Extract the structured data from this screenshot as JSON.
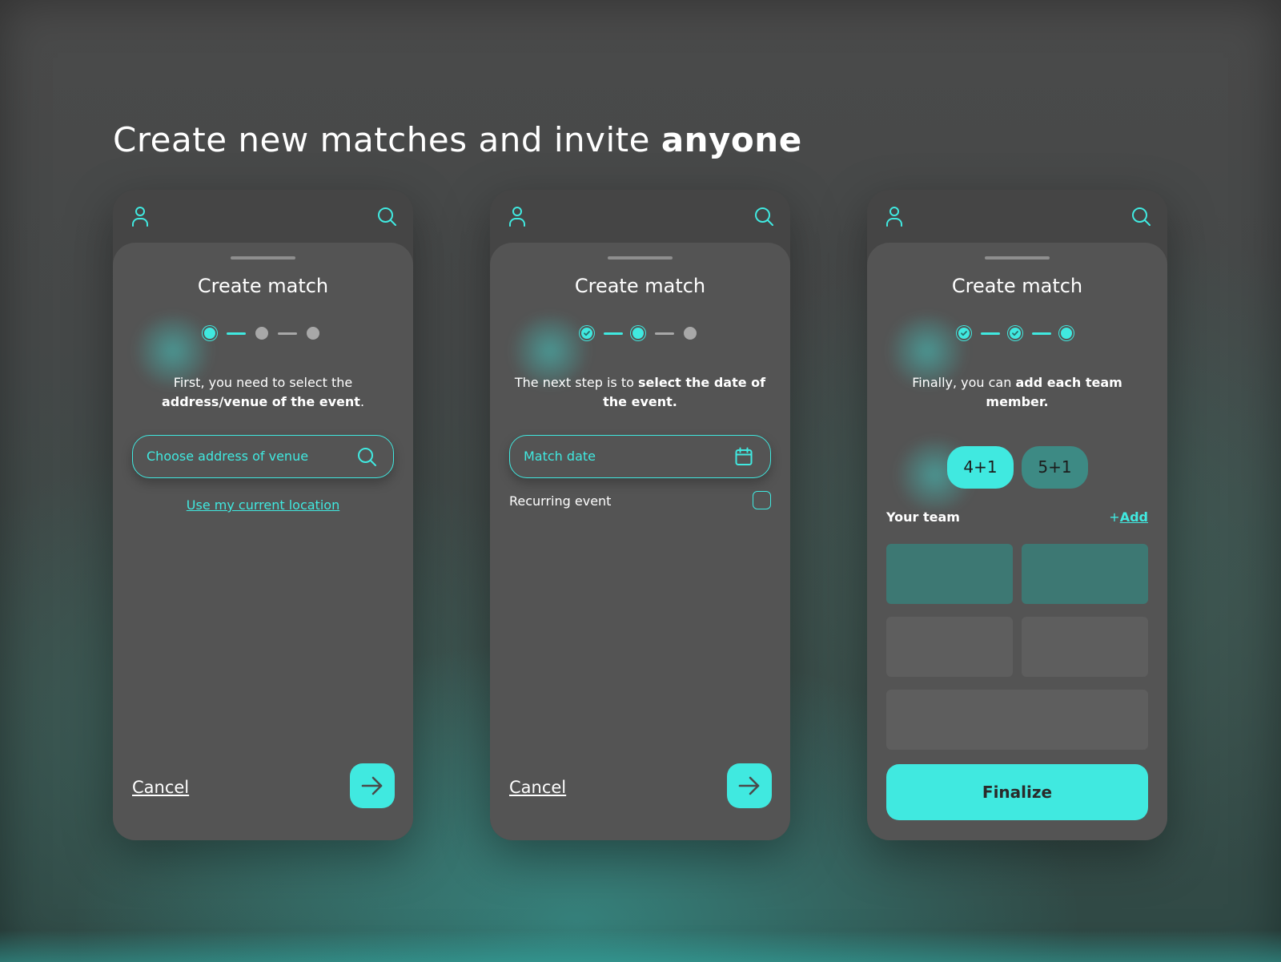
{
  "headline": {
    "regular": "Create new matches and invite ",
    "bold": "anyone"
  },
  "colors": {
    "accent": "#40e9e0",
    "card": "#545454",
    "topbar": "#454545",
    "slot_filled": "#3d7873",
    "slot_empty": "#5e5e5e"
  },
  "icons": {
    "profile": "user-icon",
    "search": "search-icon",
    "calendar": "calendar-icon",
    "next": "arrow-right-icon",
    "check": "check-icon",
    "add": "plus-icon"
  },
  "screens": [
    {
      "title": "Create match",
      "steps": [
        "current",
        "pending",
        "pending"
      ],
      "desc_regular": "First, you need to select the ",
      "desc_bold": "address/venue of the event",
      "desc_end": ".",
      "field_placeholder": "Choose address of venue",
      "location_link": "Use my current location",
      "cancel": "Cancel"
    },
    {
      "title": "Create match",
      "steps": [
        "done",
        "current",
        "pending"
      ],
      "desc_regular": "The next step is to ",
      "desc_bold": "select the date of the event.",
      "field_placeholder": "Match date",
      "recurring_label": "Recurring event",
      "recurring_checked": false,
      "cancel": "Cancel"
    },
    {
      "title": "Create match",
      "steps": [
        "done",
        "done",
        "current"
      ],
      "desc_regular": "Finally, you can ",
      "desc_bold": "add each team member.",
      "team_options": [
        "4+1",
        "5+1"
      ],
      "team_selected": "4+1",
      "your_team": "Your team",
      "add_label": "Add",
      "add_prefix": "+",
      "finalize": "Finalize"
    }
  ]
}
